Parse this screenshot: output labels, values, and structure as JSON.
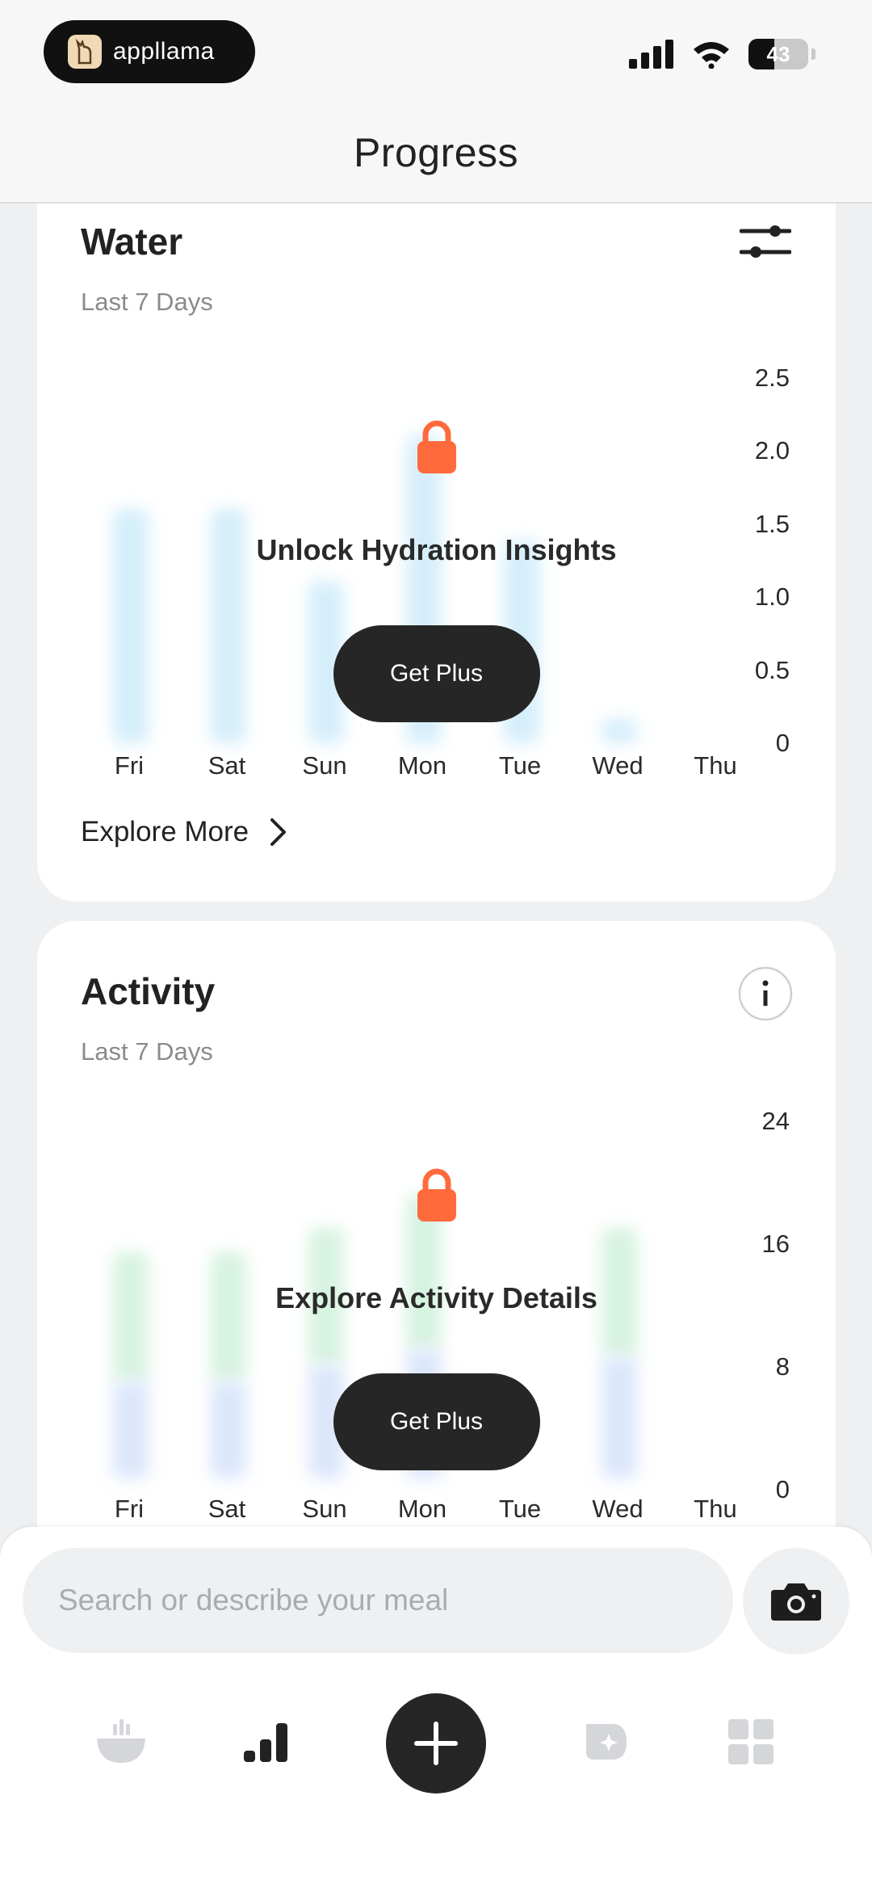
{
  "status": {
    "brand": "appllama",
    "battery": "43"
  },
  "header": {
    "title": "Progress"
  },
  "water": {
    "title": "Water",
    "subtitle": "Last 7 Days",
    "y_ticks": [
      "2.5",
      "2.0",
      "1.5",
      "1.0",
      "0.5",
      "0"
    ],
    "days": [
      "Fri",
      "Sat",
      "Sun",
      "Mon",
      "Tue",
      "Wed",
      "Thu"
    ],
    "locked_title": "Unlock Hydration Insights",
    "cta": "Get Plus",
    "explore": "Explore More"
  },
  "activity": {
    "title": "Activity",
    "subtitle": "Last 7 Days",
    "y_ticks": [
      "24",
      "16",
      "8",
      "0"
    ],
    "days": [
      "Fri",
      "Sat",
      "Sun",
      "Mon",
      "Tue",
      "Wed",
      "Thu"
    ],
    "locked_title": "Explore Activity Details",
    "cta": "Get Plus"
  },
  "search": {
    "placeholder": "Search or describe your meal"
  },
  "colors": {
    "lock": "#ff6a3d",
    "cta": "#262626",
    "water_bar": "#d4eefb",
    "activity_top": "#d6f3e0",
    "activity_bottom": "#dbe6fb"
  }
}
